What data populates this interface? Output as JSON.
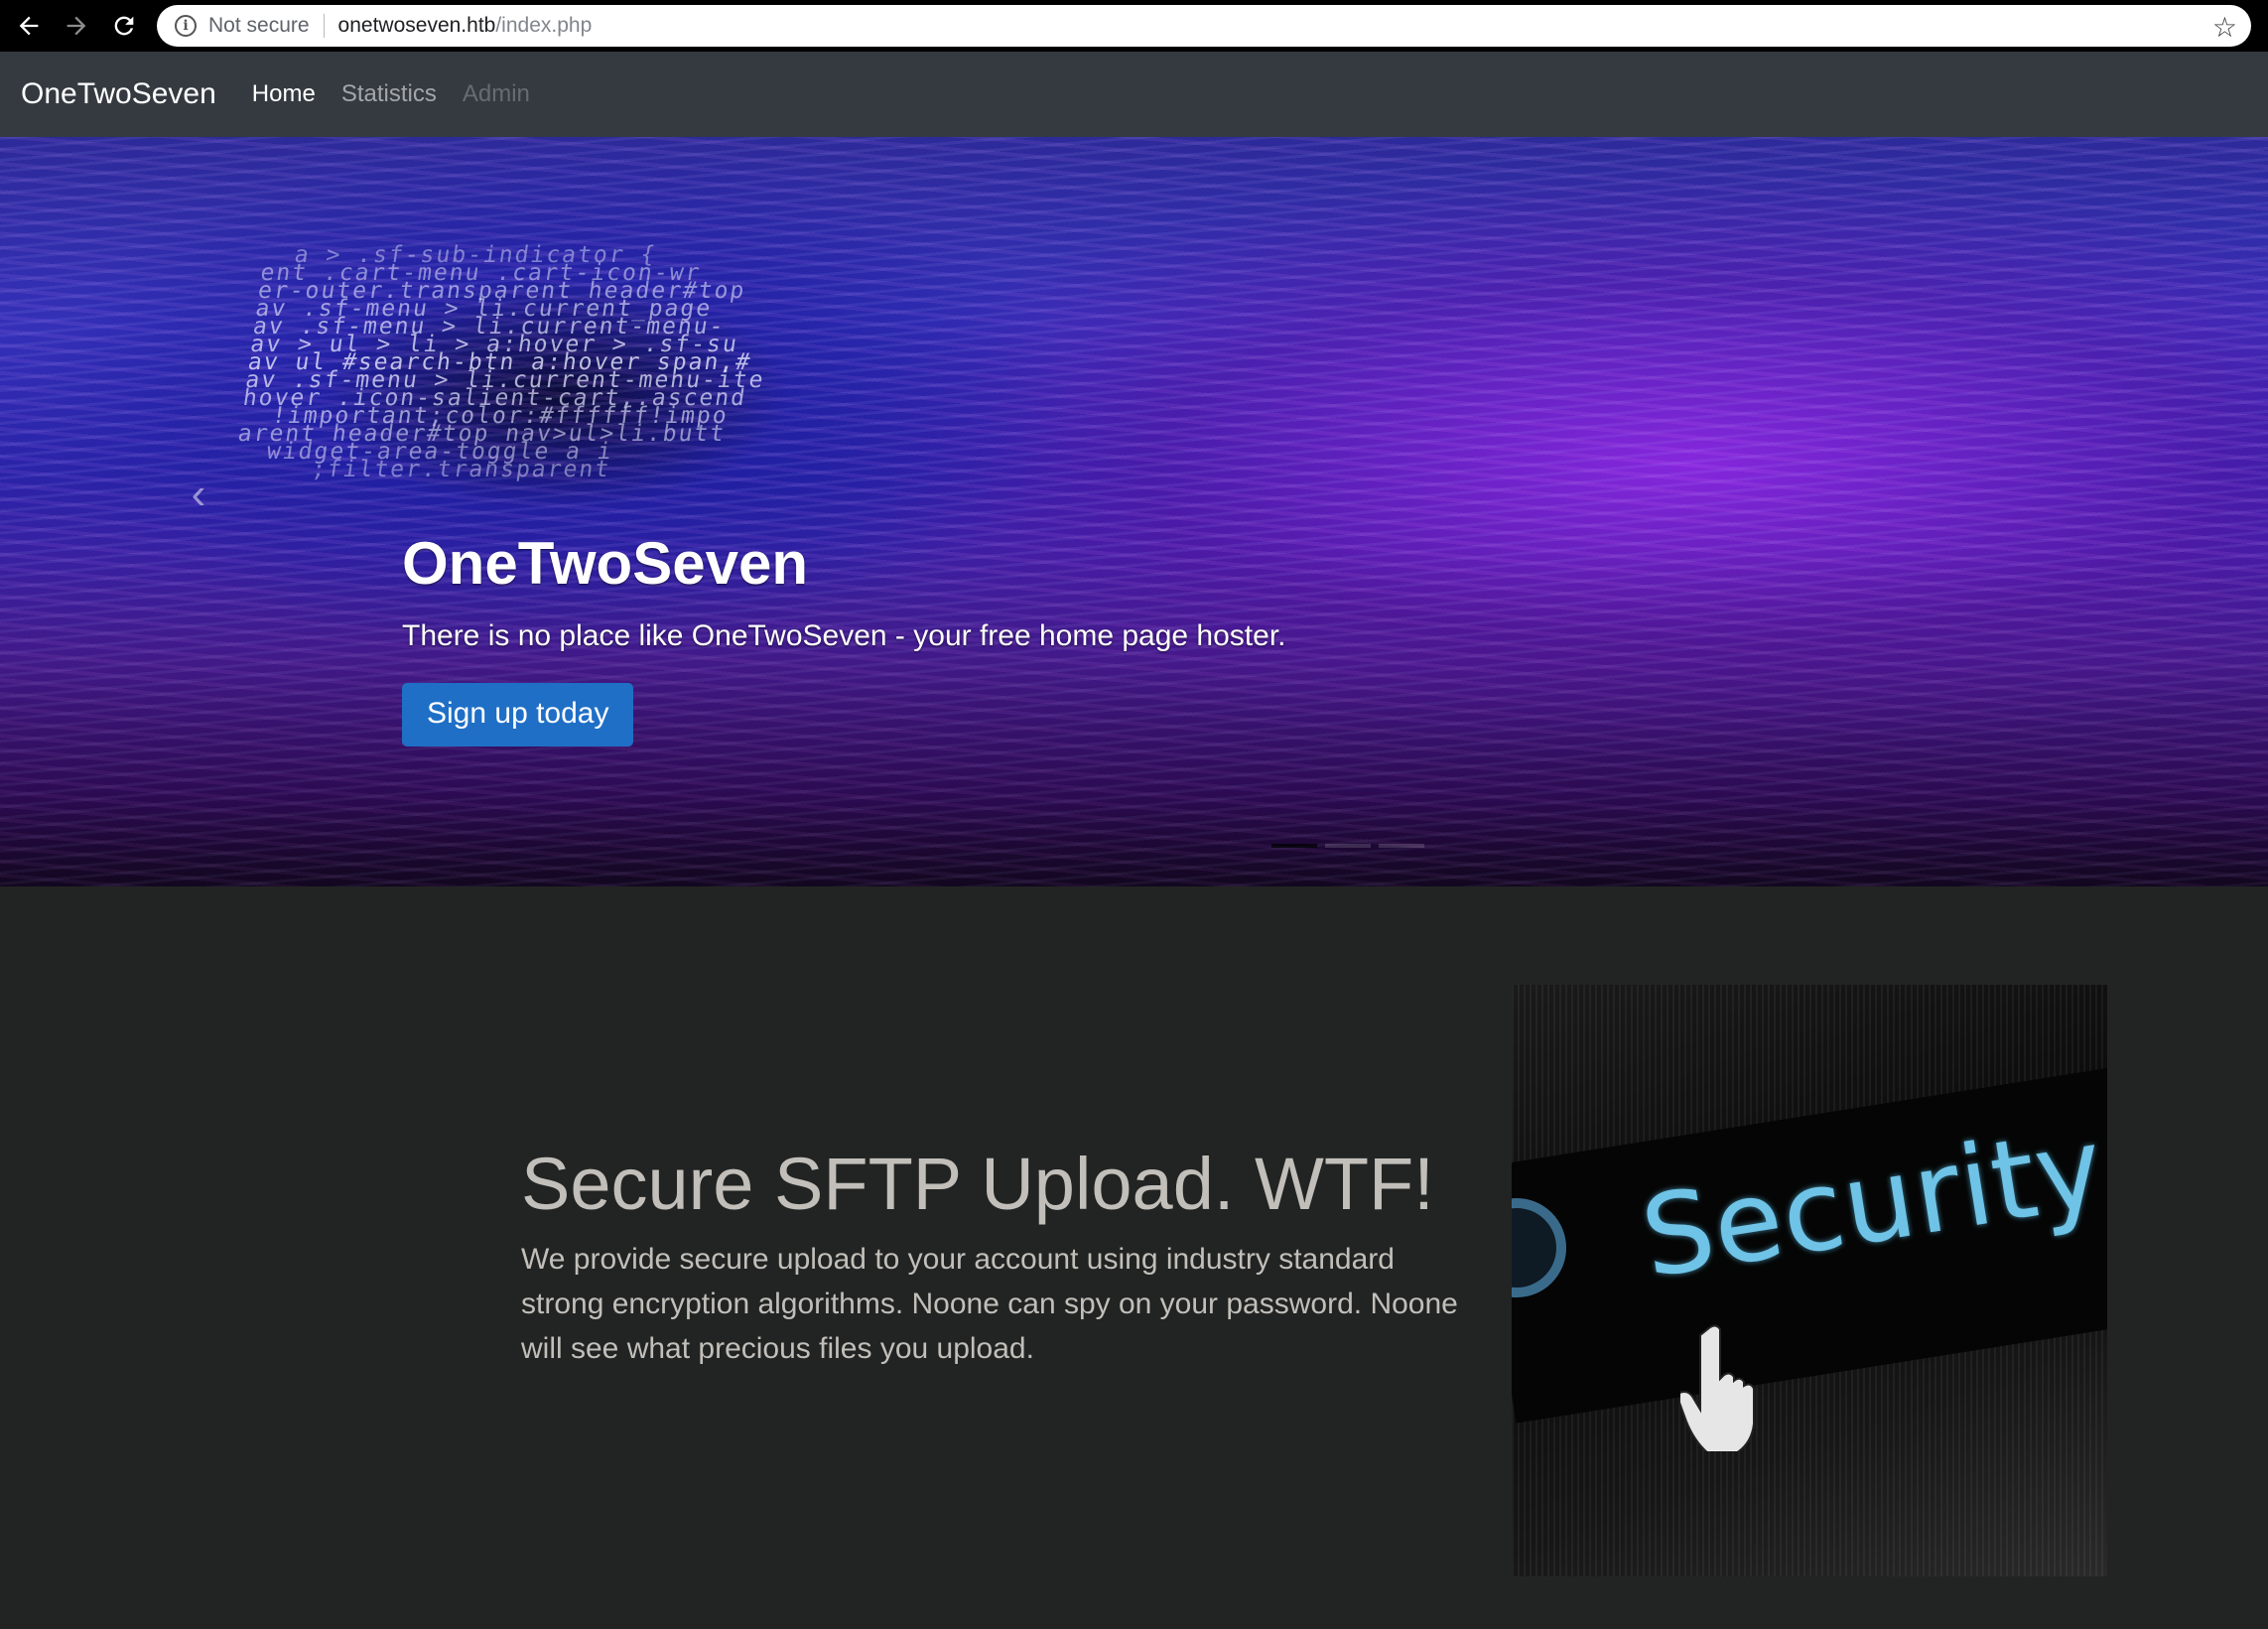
{
  "browser": {
    "security_label": "Not secure",
    "url_host": "onetwoseven.htb",
    "url_path": "/index.php"
  },
  "navbar": {
    "brand": "OneTwoSeven",
    "links": [
      {
        "label": "Home",
        "state": "active"
      },
      {
        "label": "Statistics",
        "state": "normal"
      },
      {
        "label": "Admin",
        "state": "disabled"
      }
    ]
  },
  "hero": {
    "title": "OneTwoSeven",
    "lead": "There is no place like OneTwoSeven - your free home page hoster.",
    "button_label": "Sign up today",
    "code_lines": [
      "  a > .sf-sub-indicator {",
      "ent .cart-menu .cart-icon-wr",
      "er-outer.transparent header#top",
      "av .sf-menu > li.current_page",
      "av .sf-menu > li.current-menu-",
      "av > ul > li > a:hover > .sf-su",
      "av ul #search-btn a:hover span,#",
      "av .sf-menu > li.current-menu-ite",
      "hover .icon-salient-cart,.ascend",
      "  !important;color:#ffffff!impo",
      "arent header#top nav>ul>li.butt",
      "  widget-area-toggle a i",
      "     ;filter.transparent"
    ],
    "active_slide": 1,
    "slide_count": 3
  },
  "feature": {
    "title": "Secure SFTP Upload. WTF!",
    "text": "We provide secure upload to your account using industry standard strong encryption algorithms. Noone can spy on your password. Noone will see what precious files you upload.",
    "image_word": "Security"
  }
}
